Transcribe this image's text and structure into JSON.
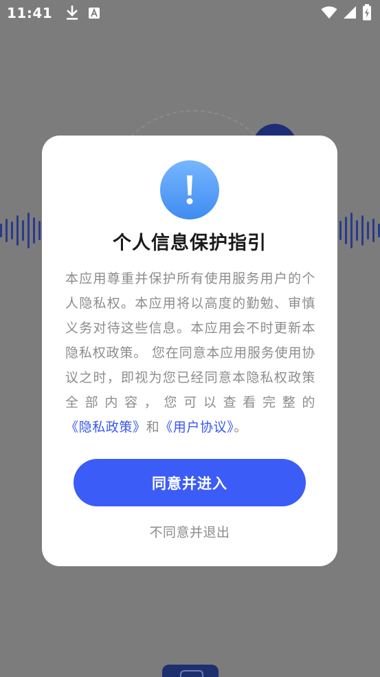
{
  "status_bar": {
    "time": "11:41",
    "icons": [
      "download-icon",
      "font-a-icon",
      "wifi-icon",
      "signal-icon",
      "battery-charging-icon"
    ]
  },
  "dialog": {
    "icon": "exclamation-icon",
    "title": "个人信息保护指引",
    "body_text": "本应用尊重并保护所有使用服务用户的个人隐私权。本应用将以高度的勤勉、审慎义务对待这些信息。本应用会不时更新本隐私权政策。 您在同意本应用服务使用协议之时，即视为您已经同意本隐私权政策全部内容，您可以查看完整的",
    "privacy_link": "《隐私政策》",
    "and_text": "和",
    "user_agreement_link": "《用户协议》",
    "end_text": "。",
    "agree_button": "同意并进入",
    "disagree_link": "不同意并退出"
  },
  "colors": {
    "overlay": "#7c7c7c",
    "accent": "#3b5cf6",
    "link": "#3756f2",
    "icon_gradient_top": "#76b6ff",
    "icon_gradient_bottom": "#3f8cf0",
    "body_text": "#8c8c8c",
    "title_text": "#1a1a1a"
  }
}
